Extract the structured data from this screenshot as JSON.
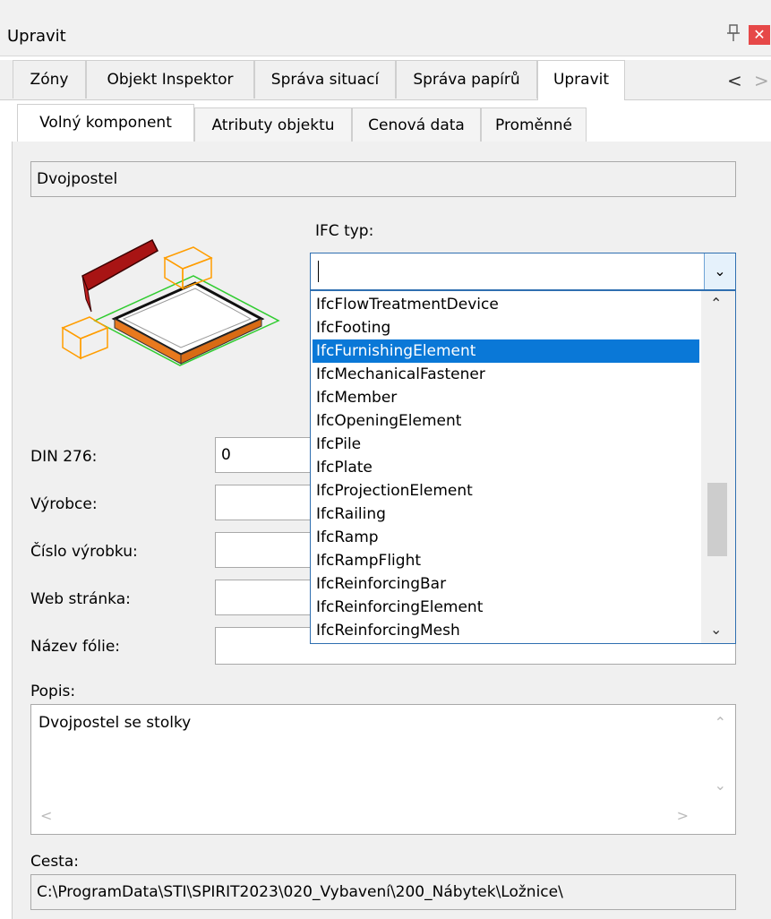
{
  "window": {
    "title": "Upravit",
    "pin_glyph": "📌",
    "close_glyph": "✕"
  },
  "top_tabs": [
    {
      "label": "Zóny",
      "active": false
    },
    {
      "label": "Objekt Inspektor",
      "active": false
    },
    {
      "label": "Správa situací",
      "active": false
    },
    {
      "label": "Správa papírů",
      "active": false
    },
    {
      "label": "Upravit",
      "active": true
    }
  ],
  "tab_nav": {
    "left": "<",
    "right": ">"
  },
  "sub_tabs": [
    {
      "label": "Volný komponent",
      "active": true
    },
    {
      "label": "Atributy objektu",
      "active": false
    },
    {
      "label": "Cenová data",
      "active": false
    },
    {
      "label": "Proměnné",
      "active": false
    }
  ],
  "component": {
    "name": "Dvojpostel",
    "preview_icon": "bed-preview-icon"
  },
  "ifc": {
    "label": "IFC typ:",
    "value": "",
    "options": [
      "IfcFlowTreatmentDevice",
      "IfcFooting",
      "IfcFurnishingElement",
      "IfcMechanicalFastener",
      "IfcMember",
      "IfcOpeningElement",
      "IfcPile",
      "IfcPlate",
      "IfcProjectionElement",
      "IfcRailing",
      "IfcRamp",
      "IfcRampFlight",
      "IfcReinforcingBar",
      "IfcReinforcingElement",
      "IfcReinforcingMesh"
    ],
    "selected": "IfcFurnishingElement"
  },
  "fields": {
    "din276": {
      "label": "DIN 276:",
      "value": "0"
    },
    "vyrobce": {
      "label": "Výrobce:",
      "value": ""
    },
    "cislo": {
      "label": "Číslo výrobku:",
      "value": ""
    },
    "web": {
      "label": "Web stránka:",
      "value": ""
    },
    "folie": {
      "label": "Název fólie:",
      "value": ""
    }
  },
  "popis": {
    "label": "Popis:",
    "value": "Dvojpostel se stolky"
  },
  "cesta": {
    "label": "Cesta:",
    "value": "C:\\ProgramData\\STI\\SPIRIT2023\\020_Vybavení\\200_Nábytek\\Ložnice\\"
  },
  "colors": {
    "selection": "#0a78d7",
    "accent_border": "#2f6fb0",
    "close": "#e64848"
  }
}
